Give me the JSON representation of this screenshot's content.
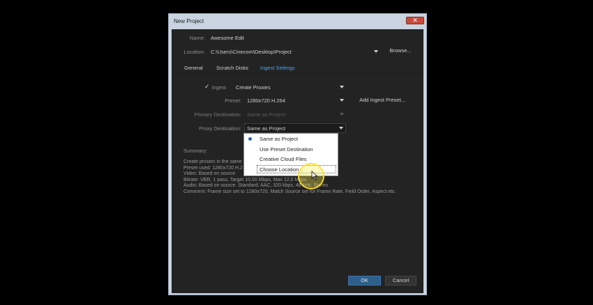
{
  "window": {
    "title": "New Project",
    "close_glyph": "✕"
  },
  "fields": {
    "name_label": "Name:",
    "name_value": "Awesome Edit",
    "location_label": "Location:",
    "location_value": "C:\\Users\\Cinecom\\Desktop\\Project",
    "browse_label": "Browse..."
  },
  "tabs": [
    {
      "label": "General"
    },
    {
      "label": "Scratch Disks"
    },
    {
      "label": "Ingest Settings"
    }
  ],
  "ingest": {
    "check_glyph": "✓",
    "label": "Ingest",
    "mode_value": "Create Proxies",
    "preset_label": "Preset:",
    "preset_value": "1280x720 H.264",
    "add_preset_button": "Add Ingest Preset...",
    "primary_label": "Primary Destination:",
    "primary_value": "Same as Project",
    "proxy_label": "Proxy Destination:",
    "proxy_value": "Same as Project"
  },
  "dropdown_menu": {
    "items": [
      {
        "label": "Same as Project",
        "selected": true
      },
      {
        "label": "Use Preset Destination",
        "selected": false
      },
      {
        "label": "Creative Cloud Files",
        "selected": false
      },
      {
        "label": "Choose Location...",
        "selected": false
      }
    ]
  },
  "summary": {
    "title": "Summary:",
    "lines": [
      "Create proxies in the same",
      "Preset used: 1280x720 H.2",
      "Video: Based on source",
      "Bitrate: VBR, 1 pass, Target 10,00 Mbps, Max 12,0 Mbps",
      "Audio: Based on source. Standard: AAC, 320 kbps, 48 kHz, Stereo",
      "Comment: Frame size set to 1280x720. Match Source set for Frame Rate, Field Order, Aspect etc."
    ]
  },
  "buttons": {
    "ok": "OK",
    "cancel": "Cancel"
  },
  "colors": {
    "accent": "#4fa3e8",
    "ok_button": "#2d5f8a",
    "cursor_highlight": "#ffe128"
  }
}
